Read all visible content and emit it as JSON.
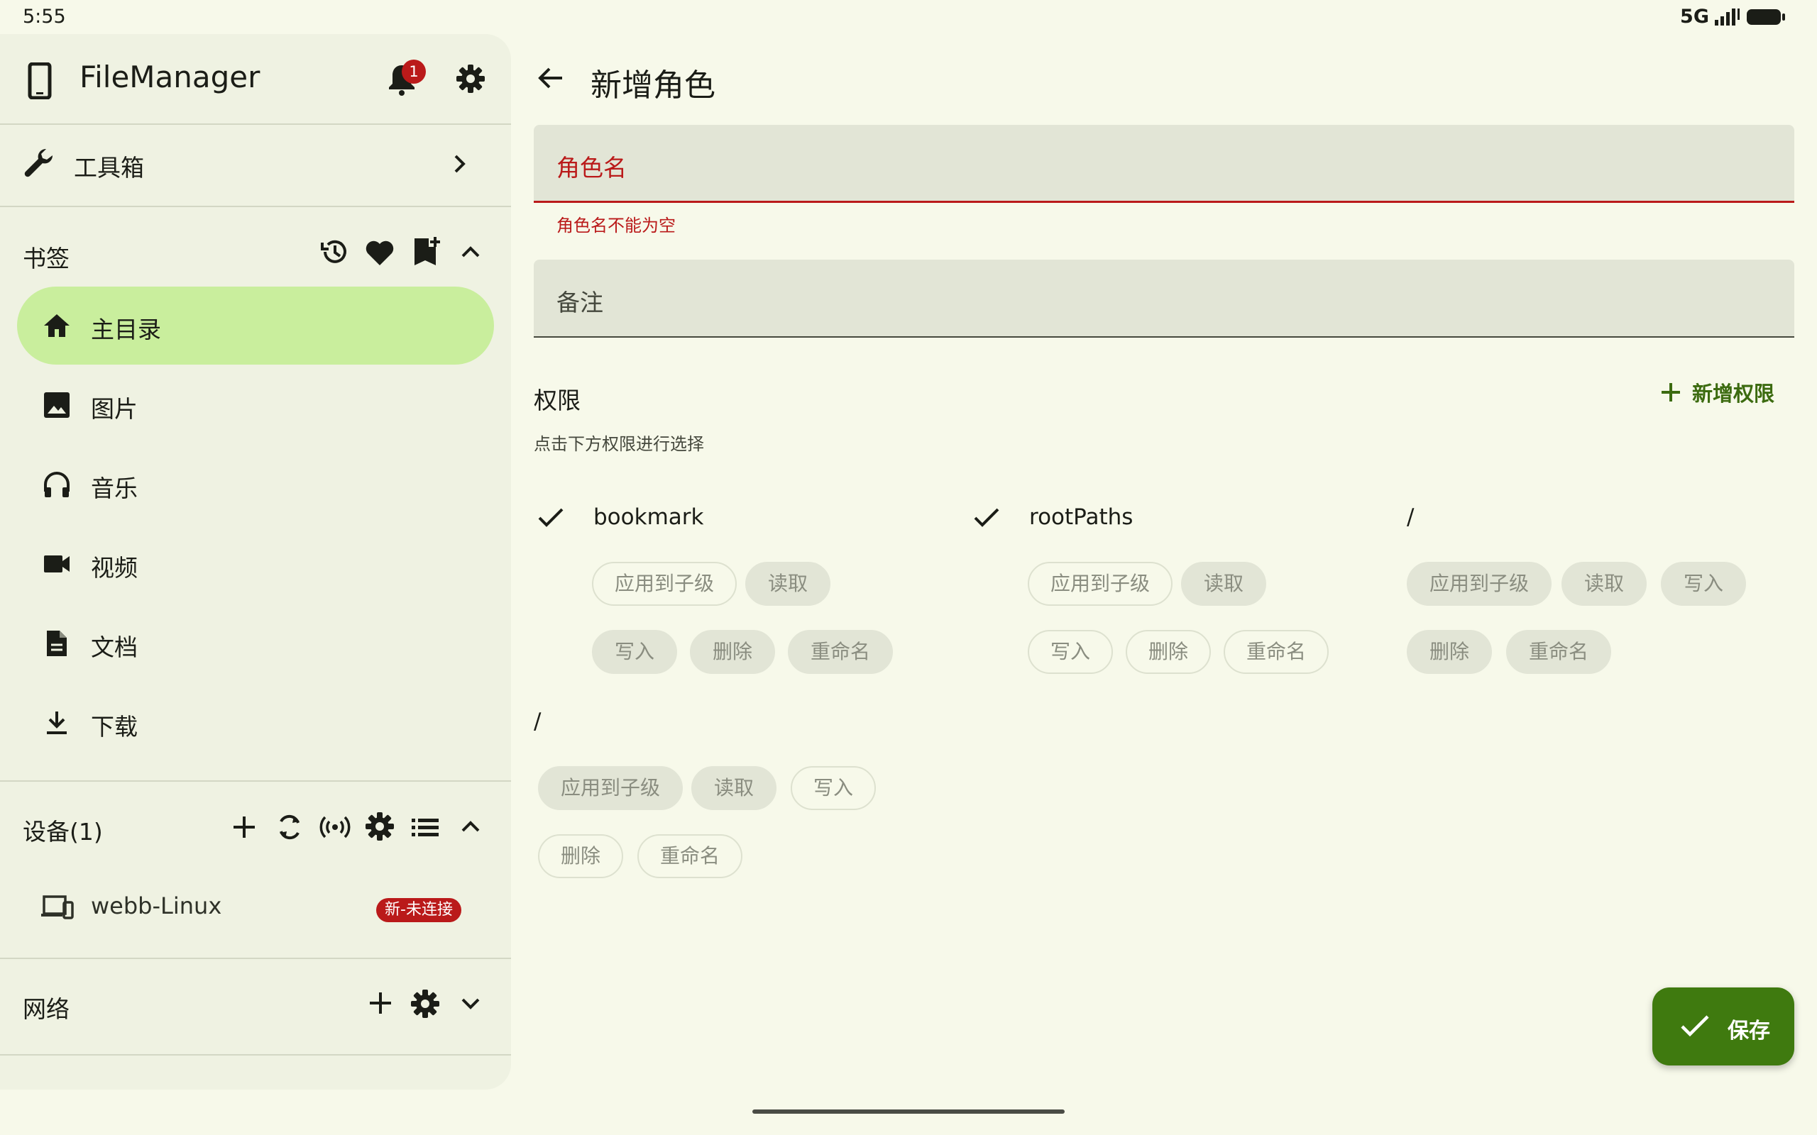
{
  "status_bar": {
    "time": "5:55",
    "network": "5G"
  },
  "sidebar": {
    "app_title": "FileManager",
    "notification_count": "1",
    "tools": {
      "label": "工具箱"
    },
    "bookmarks": {
      "title": "书签",
      "items": [
        {
          "label": "主目录",
          "icon": "home-icon",
          "active": true
        },
        {
          "label": "图片",
          "icon": "image-icon"
        },
        {
          "label": "音乐",
          "icon": "headphones-icon"
        },
        {
          "label": "视频",
          "icon": "video-icon"
        },
        {
          "label": "文档",
          "icon": "document-icon"
        },
        {
          "label": "下载",
          "icon": "download-icon"
        }
      ]
    },
    "devices": {
      "title": "设备(1)",
      "items": [
        {
          "name": "webb-Linux",
          "badge": "新-未连接"
        }
      ]
    },
    "network": {
      "title": "网络"
    }
  },
  "main": {
    "title": "新增角色",
    "role_name": {
      "label": "角色名",
      "value": "",
      "error": "角色名不能为空"
    },
    "note": {
      "label": "备注",
      "value": ""
    },
    "permissions": {
      "title": "权限",
      "add_label": "新增权限",
      "hint": "点击下方权限进行选择",
      "groups": [
        {
          "name": "bookmark",
          "checked": true,
          "chips": [
            {
              "label": "应用到子级",
              "selected": false
            },
            {
              "label": "读取",
              "selected": true
            },
            {
              "label": "写入",
              "selected": true
            },
            {
              "label": "删除",
              "selected": true
            },
            {
              "label": "重命名",
              "selected": true
            }
          ]
        },
        {
          "name": "rootPaths",
          "checked": true,
          "chips": [
            {
              "label": "应用到子级",
              "selected": false
            },
            {
              "label": "读取",
              "selected": true
            },
            {
              "label": "写入",
              "selected": false
            },
            {
              "label": "删除",
              "selected": false
            },
            {
              "label": "重命名",
              "selected": false
            }
          ]
        },
        {
          "name": "/",
          "checked": false,
          "chips": [
            {
              "label": "应用到子级",
              "selected": true
            },
            {
              "label": "读取",
              "selected": true
            },
            {
              "label": "写入",
              "selected": true
            },
            {
              "label": "删除",
              "selected": true
            },
            {
              "label": "重命名",
              "selected": true
            }
          ]
        },
        {
          "name": "/",
          "checked": false,
          "chips": [
            {
              "label": "应用到子级",
              "selected": true
            },
            {
              "label": "读取",
              "selected": true
            },
            {
              "label": "写入",
              "selected": false
            },
            {
              "label": "删除",
              "selected": false
            },
            {
              "label": "重命名",
              "selected": false
            }
          ]
        }
      ]
    },
    "save_label": "保存"
  },
  "colors": {
    "accent": "#3f7a0f",
    "error": "#ba1a1a",
    "active_nav": "#c9ee9d",
    "background": "#f7f9ea"
  }
}
